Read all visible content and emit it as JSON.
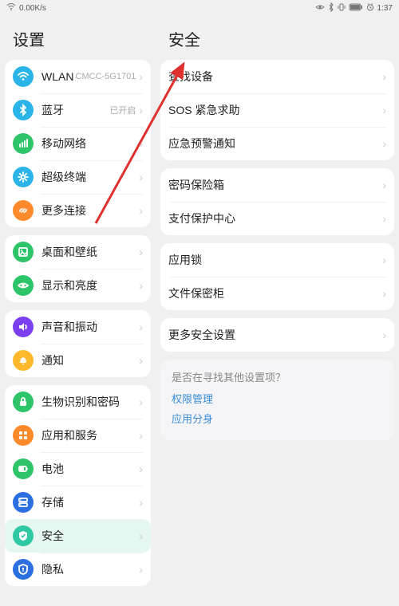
{
  "statusBar": {
    "speed": "0.00K/s",
    "time": "1:37"
  },
  "leftTitle": "设置",
  "rightTitle": "安全",
  "leftGroups": [
    {
      "items": [
        {
          "icon": "wifi",
          "iconColor": "#2bb4e8",
          "name": "wlan",
          "label": "WLAN",
          "sub": "CMCC-5G1701"
        },
        {
          "icon": "bt",
          "iconColor": "#2bb4e8",
          "name": "bluetooth",
          "label": "蓝牙",
          "sub": "已开启"
        },
        {
          "icon": "net",
          "iconColor": "#2ec46a",
          "name": "mobile-network",
          "label": "移动网络",
          "sub": ""
        },
        {
          "icon": "gear",
          "iconColor": "#2bb4e8",
          "name": "super-terminal",
          "label": "超级终端",
          "sub": ""
        },
        {
          "icon": "link",
          "iconColor": "#ff8a2b",
          "name": "more-connections",
          "label": "更多连接",
          "sub": ""
        }
      ]
    },
    {
      "items": [
        {
          "icon": "pic",
          "iconColor": "#2ec46a",
          "name": "desktop-wallpaper",
          "label": "桌面和壁纸",
          "sub": ""
        },
        {
          "icon": "eye",
          "iconColor": "#2ec46a",
          "name": "display-brightness",
          "label": "显示和亮度",
          "sub": ""
        }
      ]
    },
    {
      "items": [
        {
          "icon": "sound",
          "iconColor": "#7b3ff0",
          "name": "sound-vibration",
          "label": "声音和振动",
          "sub": ""
        },
        {
          "icon": "bell",
          "iconColor": "#ffb82b",
          "name": "notifications",
          "label": "通知",
          "sub": ""
        }
      ]
    },
    {
      "items": [
        {
          "icon": "lock",
          "iconColor": "#2ec46a",
          "name": "biometric-password",
          "label": "生物识别和密码",
          "sub": ""
        },
        {
          "icon": "apps",
          "iconColor": "#ff8a2b",
          "name": "apps-services",
          "label": "应用和服务",
          "sub": ""
        },
        {
          "icon": "batt",
          "iconColor": "#2ec46a",
          "name": "battery",
          "label": "电池",
          "sub": ""
        },
        {
          "icon": "stor",
          "iconColor": "#2b6fe0",
          "name": "storage",
          "label": "存储",
          "sub": ""
        },
        {
          "icon": "shield",
          "iconColor": "#2ec9a3",
          "name": "security",
          "label": "安全",
          "sub": "",
          "selected": true
        },
        {
          "icon": "priv",
          "iconColor": "#2b6fe0",
          "name": "privacy",
          "label": "隐私",
          "sub": ""
        }
      ]
    }
  ],
  "rightGroups": [
    {
      "items": [
        {
          "name": "find-device",
          "label": "查找设备"
        },
        {
          "name": "sos-emergency",
          "label": "SOS 紧急求助"
        },
        {
          "name": "emergency-alert",
          "label": "应急预警通知"
        }
      ]
    },
    {
      "items": [
        {
          "name": "password-vault",
          "label": "密码保险箱"
        },
        {
          "name": "payment-protection",
          "label": "支付保护中心"
        }
      ]
    },
    {
      "items": [
        {
          "name": "app-lock",
          "label": "应用锁"
        },
        {
          "name": "file-safe",
          "label": "文件保密柜"
        }
      ]
    },
    {
      "items": [
        {
          "name": "more-security",
          "label": "更多安全设置"
        }
      ]
    }
  ],
  "hint": {
    "title": "是否在寻找其他设置项？",
    "links": [
      "权限管理",
      "应用分身"
    ]
  },
  "arrow": {
    "color": "#e03030"
  }
}
